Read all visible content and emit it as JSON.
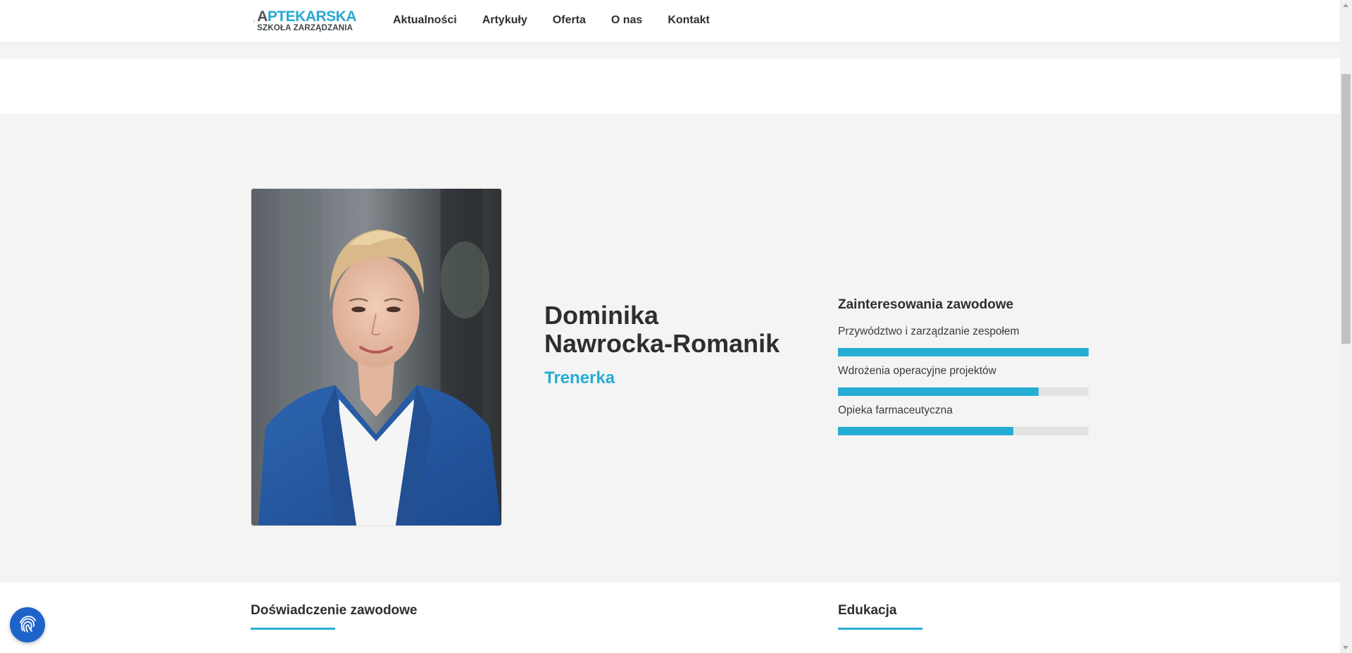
{
  "header": {
    "logo": {
      "line1_first": "A",
      "line1_rest": "PTEKARSKA",
      "line2": "SZKOŁA ZARZĄDZANIA"
    },
    "nav": [
      "Aktualności",
      "Artykuły",
      "Oferta",
      "O nas",
      "Kontakt"
    ]
  },
  "profile": {
    "name": "Dominika Nawrocka-Romanik",
    "role": "Trenerka",
    "photo_icon": "portrait-photo"
  },
  "interests": {
    "title": "Zainteresowania zawodowe",
    "items": [
      {
        "label": "Przywództwo i zarządzanie zespołem",
        "level_percent": 100
      },
      {
        "label": "Wdrożenia operacyjne projektów",
        "level_percent": 80
      },
      {
        "label": "Opieka farmaceutyczna",
        "level_percent": 70
      }
    ]
  },
  "sections": {
    "experience": "Doświadczenie zawodowe",
    "education": "Edukacja"
  },
  "widgets": {
    "fab_icon": "fingerprint-icon"
  },
  "colors": {
    "accent": "#26add3",
    "text": "#2e2e2e",
    "fab": "#1e63c9",
    "track": "#e3e3e3"
  }
}
